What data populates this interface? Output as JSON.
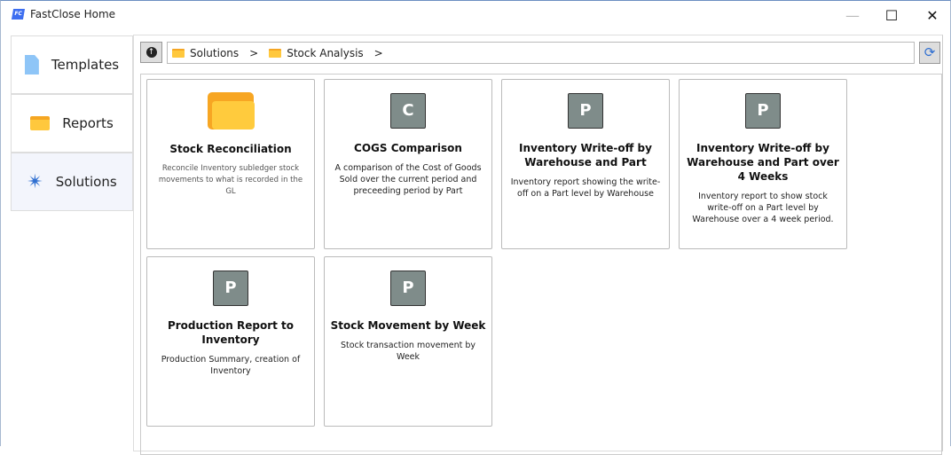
{
  "window": {
    "title": "FastClose Home",
    "logo": "FC",
    "minimize": "—",
    "maximize": "☐",
    "close": "✕"
  },
  "sidebar": {
    "items": [
      {
        "label": "Templates",
        "icon": "document-icon"
      },
      {
        "label": "Reports",
        "icon": "folder-icon"
      },
      {
        "label": "Solutions",
        "icon": "compass-star-icon"
      }
    ]
  },
  "breadcrumb": {
    "items": [
      "Solutions",
      "Stock Analysis"
    ],
    "sep": ">"
  },
  "cards": [
    {
      "badge": "",
      "title": "Stock Reconciliation",
      "desc": "Reconcile Inventory subledger stock movements to what is recorded in the GL"
    },
    {
      "badge": "C",
      "title": "COGS Comparison",
      "desc": "A comparison of the Cost of Goods Sold over the current period and preceeding period by Part"
    },
    {
      "badge": "P",
      "title": "Inventory Write-off by Warehouse and Part",
      "desc": "Inventory report showing the write-off on a Part level by Warehouse"
    },
    {
      "badge": "P",
      "title": "Inventory Write-off by Warehouse and Part over 4 Weeks",
      "desc": "Inventory report to show stock write-off on a Part level by Warehouse over a 4 week period."
    },
    {
      "badge": "P",
      "title": "Production Report to Inventory",
      "desc": "Production Summary, creation of Inventory"
    },
    {
      "badge": "P",
      "title": "Stock Movement by Week",
      "desc": "Stock transaction movement by Week"
    }
  ]
}
